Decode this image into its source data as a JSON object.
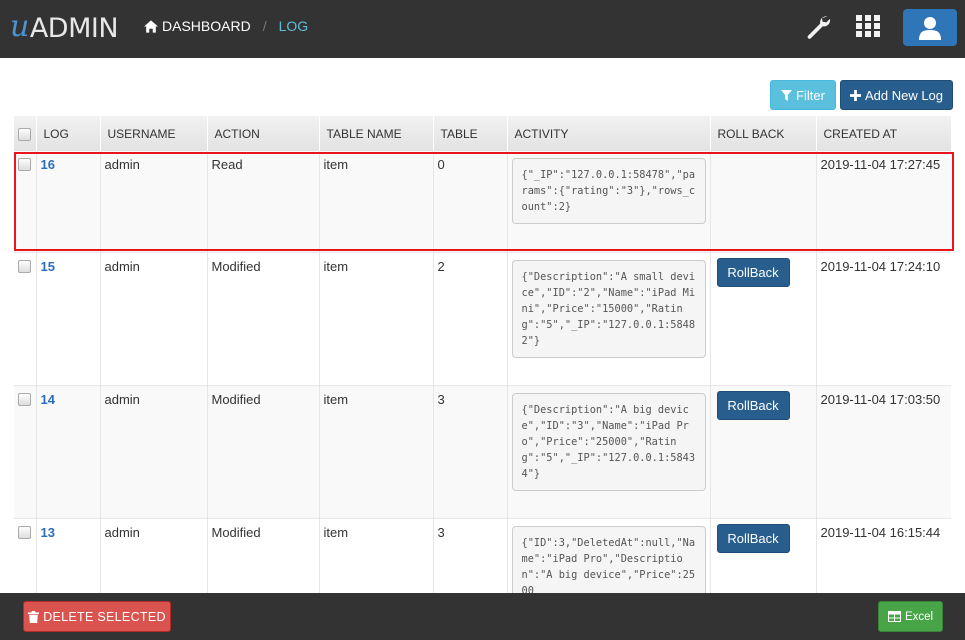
{
  "app": {
    "logo_u": "u",
    "logo_text": "ADMIN"
  },
  "breadcrumb": {
    "home": "DASHBOARD",
    "separator": "/",
    "current": "LOG"
  },
  "toolbar": {
    "filter_label": "Filter",
    "add_label": "Add New Log"
  },
  "table": {
    "columns": [
      "LOG",
      "USERNAME",
      "ACTION",
      "TABLE NAME",
      "TABLE",
      "ACTIVITY",
      "ROLL BACK",
      "CREATED AT"
    ],
    "rollback_label": "RollBack",
    "rows": [
      {
        "log": "16",
        "username": "admin",
        "action": "Read",
        "table_name": "item",
        "table": "0",
        "activity": "{\"_IP\":\"127.0.0.1:58478\",\"params\":{\"rating\":\"3\"},\"rows_count\":2}",
        "rollback": false,
        "created_at": "2019-11-04 17:27:45"
      },
      {
        "log": "15",
        "username": "admin",
        "action": "Modified",
        "table_name": "item",
        "table": "2",
        "activity": "{\"Description\":\"A small device\",\"ID\":\"2\",\"Name\":\"iPad Mini\",\"Price\":\"15000\",\"Rating\":\"5\",\"_IP\":\"127.0.0.1:58482\"}",
        "rollback": true,
        "created_at": "2019-11-04 17:24:10"
      },
      {
        "log": "14",
        "username": "admin",
        "action": "Modified",
        "table_name": "item",
        "table": "3",
        "activity": "{\"Description\":\"A big device\",\"ID\":\"3\",\"Name\":\"iPad Pro\",\"Price\":\"25000\",\"Rating\":\"5\",\"_IP\":\"127.0.0.1:58434\"}",
        "rollback": true,
        "created_at": "2019-11-04 17:03:50"
      },
      {
        "log": "13",
        "username": "admin",
        "action": "Modified",
        "table_name": "item",
        "table": "3",
        "activity": "{\"ID\":3,\"DeletedAt\":null,\"Name\":\"iPad Pro\",\"Description\":\"A big device\",\"Price\":2500",
        "rollback": true,
        "created_at": "2019-11-04 16:15:44"
      }
    ]
  },
  "footer": {
    "delete_label": "DELETE SELECTED",
    "excel_label": "Excel"
  },
  "colors": {
    "navbar": "#333333",
    "primary": "#285e8e",
    "info": "#5bc0de",
    "danger": "#d9534f",
    "success": "#47a447",
    "highlight": "#e8161b"
  },
  "icons": {
    "home": "home-icon",
    "wrench": "wrench-icon",
    "grid": "apps-grid-icon",
    "user": "user-icon",
    "filter": "filter-icon",
    "plus": "plus-icon",
    "trash": "trash-icon",
    "excel": "excel-table-icon"
  }
}
